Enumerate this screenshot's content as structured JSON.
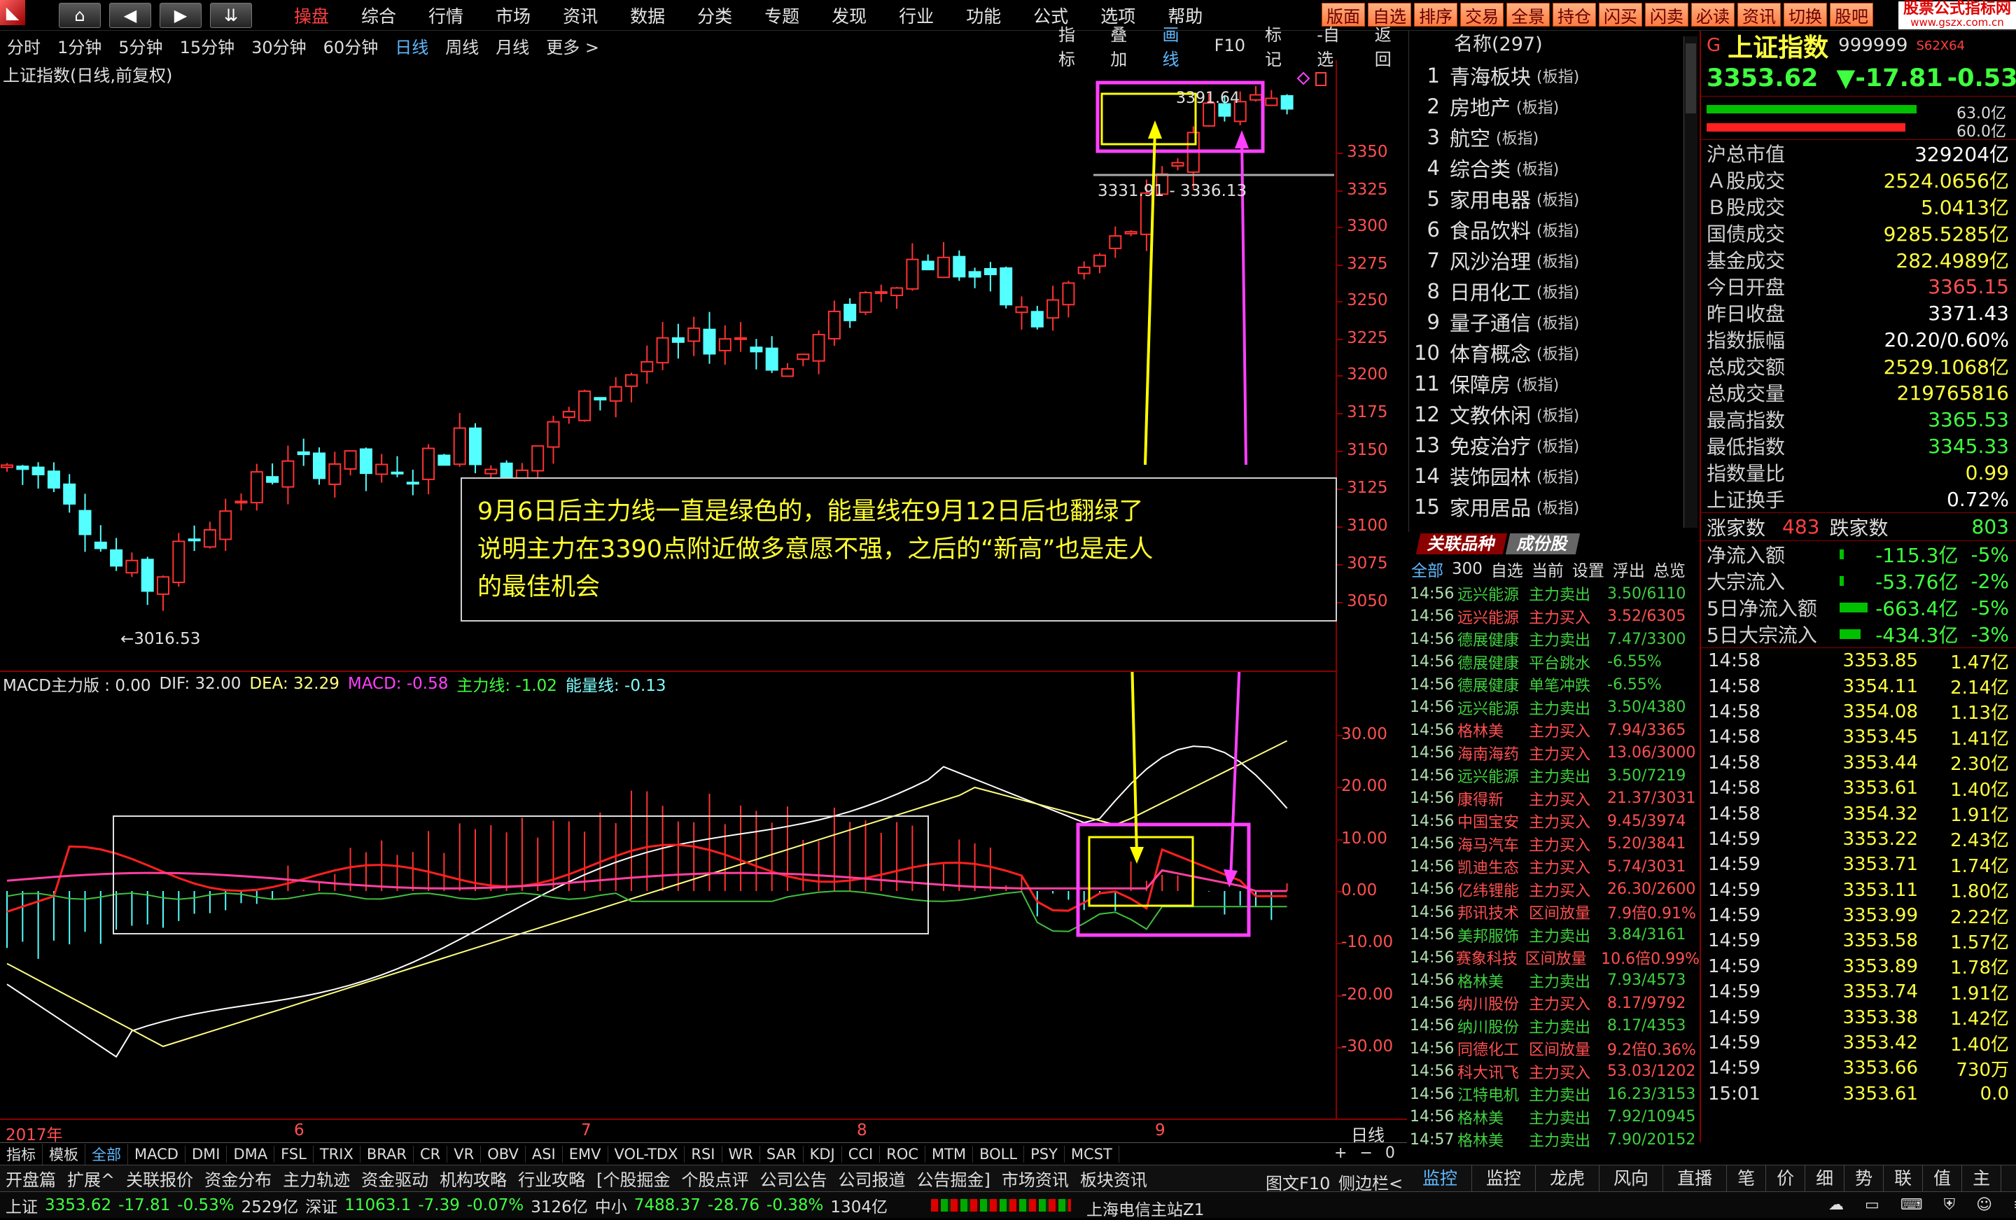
{
  "top_menu": {
    "items": [
      "操盘",
      "综合",
      "行情",
      "市场",
      "资讯",
      "数据",
      "分类",
      "专题",
      "发现",
      "行业",
      "功能",
      "公式",
      "选项",
      "帮助"
    ],
    "active": "操盘",
    "quick_buttons": [
      "版面",
      "自选",
      "排序",
      "交易",
      "全景",
      "持仓",
      "闪买",
      "闪卖",
      "必读",
      "资讯",
      "切换",
      "股吧"
    ],
    "watermark": "股票公式指标网",
    "watermark_url": "www.gszx.com.cn"
  },
  "period_bar": {
    "periods": [
      "分时",
      "1分钟",
      "5分钟",
      "15分钟",
      "30分钟",
      "60分钟",
      "日线",
      "周线",
      "月线",
      "更多 >"
    ],
    "active": "日线",
    "tools": [
      "指标",
      "叠加",
      "画线",
      "F10",
      "标记",
      "-自选",
      "返回"
    ],
    "active_tool": "画线"
  },
  "main_chart": {
    "title": "上证指数(日线,前复权)",
    "y_ticks": [
      "3350",
      "3325",
      "3300",
      "3275",
      "3250",
      "3225",
      "3200",
      "3175",
      "3150",
      "3125",
      "3100",
      "3075",
      "3050"
    ],
    "low_label": "←3016.53",
    "high_label": "3391.64",
    "range_label": "3331.91 - 3336.13"
  },
  "annotation": {
    "line1": "9月6日后主力线一直是绿色的，能量线在9月12日后也翻绿了",
    "line2": "说明主力在3390点附近做多意愿不强，之后的“新高”也是走人",
    "line3": "的最佳机会"
  },
  "macd": {
    "title": "MACD主力版 : 0.00",
    "dif": "DIF: 32.00",
    "dea": "DEA: 32.29",
    "macd": "MACD: -0.58",
    "main": "主力线: -1.02",
    "energy": "能量线: -0.13",
    "y_ticks": [
      "30.00",
      "20.00",
      "10.00",
      "0.00",
      "-10.00",
      "-20.00",
      "-30.00"
    ]
  },
  "x_axis": {
    "year": "2017年",
    "months": [
      "6",
      "7",
      "8",
      "9"
    ],
    "label": "日线"
  },
  "indicator_bar": {
    "items": [
      "指标",
      "模板",
      "全部",
      "MACD",
      "DMI",
      "DMA",
      "FSL",
      "TRIX",
      "BRAR",
      "CR",
      "VR",
      "OBV",
      "ASI",
      "EMV",
      "VOL-TDX",
      "RSI",
      "WR",
      "SAR",
      "KDJ",
      "CCI",
      "ROC",
      "MTM",
      "BOLL",
      "PSY",
      "MCST"
    ],
    "active": "全部"
  },
  "info_tabs": {
    "items": [
      "开盘篇",
      "扩展^",
      "关联报价",
      "资金分布",
      "主力轨迹",
      "资金驱动",
      "机构攻略",
      "行业攻略",
      "[个股掘金",
      "个股点评",
      "公司公告",
      "公司报道",
      "公告掘金]",
      "市场资讯",
      "板块资讯"
    ],
    "f10": "图文F10",
    "side": "侧边栏<"
  },
  "right_tabs": [
    "监控",
    "监控",
    "龙虎",
    "风向",
    "直播",
    "笔",
    "价",
    "细",
    "势",
    "联",
    "值",
    "主"
  ],
  "sectors": {
    "header": "名称(297)",
    "items": [
      {
        "n": "1",
        "name": "青海板块",
        "tag": "(板指)"
      },
      {
        "n": "2",
        "name": "房地产",
        "tag": "(板指)"
      },
      {
        "n": "3",
        "name": "航空",
        "tag": "(板指)"
      },
      {
        "n": "4",
        "name": "综合类",
        "tag": "(板指)"
      },
      {
        "n": "5",
        "name": "家用电器",
        "tag": "(板指)"
      },
      {
        "n": "6",
        "name": "食品饮料",
        "tag": "(板指)"
      },
      {
        "n": "7",
        "name": "风沙治理",
        "tag": "(板指)"
      },
      {
        "n": "8",
        "name": "日用化工",
        "tag": "(板指)"
      },
      {
        "n": "9",
        "name": "量子通信",
        "tag": "(板指)"
      },
      {
        "n": "10",
        "name": "体育概念",
        "tag": "(板指)"
      },
      {
        "n": "11",
        "name": "保障房",
        "tag": "(板指)"
      },
      {
        "n": "12",
        "name": "文教休闲",
        "tag": "(板指)"
      },
      {
        "n": "13",
        "name": "免疫治疗",
        "tag": "(板指)"
      },
      {
        "n": "14",
        "name": "装饰园林",
        "tag": "(板指)"
      },
      {
        "n": "15",
        "name": "家用居品",
        "tag": "(板指)"
      }
    ],
    "tab1": "关联品种",
    "tab2": "成份股",
    "filters": [
      "全部",
      "300",
      "自选",
      "当前",
      "设置",
      "浮出",
      "总览"
    ]
  },
  "trades": [
    {
      "t": "14:56",
      "n": "远兴能源",
      "a": "主力卖出",
      "v": "3.50/6110",
      "c": "#40d040"
    },
    {
      "t": "14:56",
      "n": "远兴能源",
      "a": "主力买入",
      "v": "3.52/6305",
      "c": "#ff5050"
    },
    {
      "t": "14:56",
      "n": "德展健康",
      "a": "主力卖出",
      "v": "7.47/3300",
      "c": "#40d040"
    },
    {
      "t": "14:56",
      "n": "德展健康",
      "a": "平台跳水",
      "v": "-6.55%",
      "c": "#40d040"
    },
    {
      "t": "14:56",
      "n": "德展健康",
      "a": "单笔冲跌",
      "v": "-6.55%",
      "c": "#40d040"
    },
    {
      "t": "14:56",
      "n": "远兴能源",
      "a": "主力卖出",
      "v": "3.50/4380",
      "c": "#40d040"
    },
    {
      "t": "14:56",
      "n": "格林美",
      "a": "主力买入",
      "v": "7.94/3365",
      "c": "#ff5050"
    },
    {
      "t": "14:56",
      "n": "海南海药",
      "a": "主力买入",
      "v": "13.06/3000",
      "c": "#ff5050"
    },
    {
      "t": "14:56",
      "n": "远兴能源",
      "a": "主力卖出",
      "v": "3.50/7219",
      "c": "#40d040"
    },
    {
      "t": "14:56",
      "n": "康得新",
      "a": "主力买入",
      "v": "21.37/3031",
      "c": "#ff5050"
    },
    {
      "t": "14:56",
      "n": "中国宝安",
      "a": "主力买入",
      "v": "9.45/3974",
      "c": "#ff5050"
    },
    {
      "t": "14:56",
      "n": "海马汽车",
      "a": "主力买入",
      "v": "5.20/3841",
      "c": "#ff5050"
    },
    {
      "t": "14:56",
      "n": "凯迪生态",
      "a": "主力买入",
      "v": "5.74/3031",
      "c": "#ff5050"
    },
    {
      "t": "14:56",
      "n": "亿纬锂能",
      "a": "主力买入",
      "v": "26.30/2600",
      "c": "#ff5050"
    },
    {
      "t": "14:56",
      "n": "邦讯技术",
      "a": "区间放量",
      "v": "7.9倍0.91%",
      "c": "#ff5050"
    },
    {
      "t": "14:56",
      "n": "美邦服饰",
      "a": "主力卖出",
      "v": "3.84/3161",
      "c": "#40d040"
    },
    {
      "t": "14:56",
      "n": "赛象科技",
      "a": "区间放量",
      "v": "10.6倍0.99%",
      "c": "#ff5050"
    },
    {
      "t": "14:56",
      "n": "格林美",
      "a": "主力卖出",
      "v": "7.93/4573",
      "c": "#40d040"
    },
    {
      "t": "14:56",
      "n": "纳川股份",
      "a": "主力买入",
      "v": "8.17/9792",
      "c": "#ff5050"
    },
    {
      "t": "14:56",
      "n": "纳川股份",
      "a": "主力卖出",
      "v": "8.17/4353",
      "c": "#40d040"
    },
    {
      "t": "14:56",
      "n": "同德化工",
      "a": "区间放量",
      "v": "9.2倍0.36%",
      "c": "#ff5050"
    },
    {
      "t": "14:56",
      "n": "科大讯飞",
      "a": "主力买入",
      "v": "53.03/1202",
      "c": "#ff5050"
    },
    {
      "t": "14:56",
      "n": "江特电机",
      "a": "主力卖出",
      "v": "16.23/3153",
      "c": "#40d040"
    },
    {
      "t": "14:56",
      "n": "格林美",
      "a": "主力卖出",
      "v": "7.92/10945",
      "c": "#40d040"
    },
    {
      "t": "14:57",
      "n": "格林美",
      "a": "主力卖出",
      "v": "7.90/20152",
      "c": "#40d040"
    }
  ],
  "quote": {
    "name": "上证指数",
    "code": "999999",
    "tag": "S62X64",
    "price": "3353.62",
    "change": "▼-17.81",
    "pct": "-0.53%",
    "bar1": "63.0亿",
    "bar2": "60.0亿",
    "rows": [
      {
        "k": "沪总市值",
        "v": "329204亿",
        "c": "#ffffff"
      },
      {
        "k": "Ａ股成交",
        "v": "2524.0656亿",
        "c": "#ffff40"
      },
      {
        "k": "Ｂ股成交",
        "v": "5.0413亿",
        "c": "#ffff40"
      },
      {
        "k": "国债成交",
        "v": "9285.5285亿",
        "c": "#ffff40"
      },
      {
        "k": "基金成交",
        "v": "282.4989亿",
        "c": "#ffff40"
      },
      {
        "k": "今日开盘",
        "v": "3365.15",
        "c": "#ff5050"
      },
      {
        "k": "昨日收盘",
        "v": "3371.43",
        "c": "#ffffff"
      },
      {
        "k": "指数振幅",
        "v": "20.20/0.60%",
        "c": "#ffffff"
      },
      {
        "k": "总成交额",
        "v": "2529.1068亿",
        "c": "#ffff40"
      },
      {
        "k": "总成交量",
        "v": "219765816",
        "c": "#ffff40"
      },
      {
        "k": "最高指数",
        "v": "3365.53",
        "c": "#40ff40"
      },
      {
        "k": "最低指数",
        "v": "3345.33",
        "c": "#40ff40"
      },
      {
        "k": "指数量比",
        "v": "0.99",
        "c": "#ffff40"
      },
      {
        "k": "上证换手",
        "v": "0.72%",
        "c": "#ffffff"
      }
    ],
    "up_label": "涨家数",
    "up": "483",
    "down_label": "跌家数",
    "down": "803",
    "flows": [
      {
        "k": "净流入额",
        "v": "-115.3亿",
        "p": "-5%"
      },
      {
        "k": "大宗流入",
        "v": "-53.76亿",
        "p": "-2%"
      },
      {
        "k": "5日净流入额",
        "v": "-663.4亿",
        "p": "-5%"
      },
      {
        "k": "5日大宗流入",
        "v": "-434.3亿",
        "p": "-3%"
      }
    ]
  },
  "ticks": [
    {
      "t": "14:58",
      "p": "3353.85",
      "a": "1.47亿"
    },
    {
      "t": "14:58",
      "p": "3354.11",
      "a": "2.14亿"
    },
    {
      "t": "14:58",
      "p": "3354.08",
      "a": "1.13亿"
    },
    {
      "t": "14:58",
      "p": "3353.45",
      "a": "1.41亿"
    },
    {
      "t": "14:58",
      "p": "3353.44",
      "a": "2.30亿"
    },
    {
      "t": "14:58",
      "p": "3353.61",
      "a": "1.40亿"
    },
    {
      "t": "14:58",
      "p": "3354.32",
      "a": "1.91亿"
    },
    {
      "t": "14:59",
      "p": "3353.22",
      "a": "2.43亿"
    },
    {
      "t": "14:59",
      "p": "3353.71",
      "a": "1.74亿"
    },
    {
      "t": "14:59",
      "p": "3353.11",
      "a": "1.80亿"
    },
    {
      "t": "14:59",
      "p": "3353.99",
      "a": "2.22亿"
    },
    {
      "t": "14:59",
      "p": "3353.58",
      "a": "1.57亿"
    },
    {
      "t": "14:59",
      "p": "3353.89",
      "a": "1.78亿"
    },
    {
      "t": "14:59",
      "p": "3353.74",
      "a": "1.91亿"
    },
    {
      "t": "14:59",
      "p": "3353.38",
      "a": "1.42亿"
    },
    {
      "t": "14:59",
      "p": "3353.42",
      "a": "1.40亿"
    },
    {
      "t": "14:59",
      "p": "3353.66",
      "a": "730万"
    },
    {
      "t": "15:01",
      "p": "3353.61",
      "a": "0.0"
    }
  ],
  "status": {
    "sh_label": "上证",
    "sh_price": "3353.62",
    "sh_chg": "-17.81",
    "sh_pct": "-0.53%",
    "sh_amt": "2529亿",
    "sz_label": "深证",
    "sz_price": "11063.1",
    "sz_chg": "-7.39",
    "sz_pct": "-0.07%",
    "sz_amt": "3126亿",
    "zx_label": "中小",
    "zx_price": "7488.37",
    "zx_chg": "-28.76",
    "zx_pct": "-0.38%",
    "zx_amt": "1304亿",
    "server": "上海电信主站Z1"
  },
  "colors": {
    "up": "#ff3232",
    "down": "#54ffff",
    "bg": "#000000",
    "frame": "#8b0000",
    "annotation_border": "#ff40ff",
    "highlight": "#ffff00"
  }
}
